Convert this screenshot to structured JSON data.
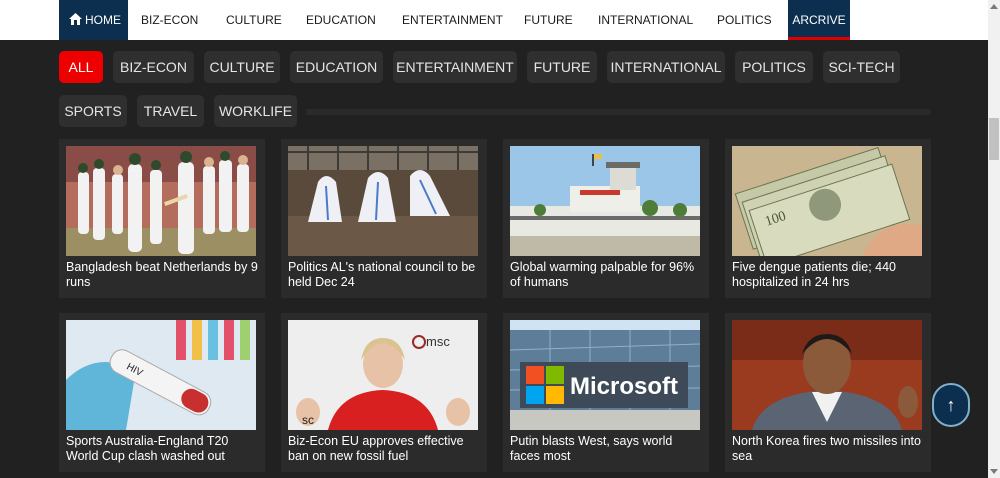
{
  "nav": {
    "home": "HOME",
    "items": [
      "BIZ-ECON",
      "CULTURE",
      "EDUCATION",
      "ENTERTAINMENT",
      "FUTURE",
      "INTERNATIONAL",
      "POLITICS"
    ],
    "active": "ARCRIVE"
  },
  "filters": [
    "ALL",
    "BIZ-ECON",
    "CULTURE",
    "EDUCATION",
    "ENTERTAINMENT",
    "FUTURE",
    "INTERNATIONAL",
    "POLITICS",
    "SCI-TECH",
    "SPORTS",
    "TRAVEL",
    "WORKLIFE"
  ],
  "active_filter": "ALL",
  "articles": [
    {
      "title": "Bangladesh beat Netherlands by 9 runs",
      "image": "cricket-players"
    },
    {
      "title": "Politics AL's national council to be held Dec 24",
      "image": "ppe-workers-grave"
    },
    {
      "title": "Global warming palpable for 96% of humans",
      "image": "airport-building"
    },
    {
      "title": "Five dengue patients die; 440 hospitalized in 24 hrs",
      "image": "dollar-bills"
    },
    {
      "title": "Sports Australia-England T20 World Cup clash washed out",
      "image": "hiv-test-tube"
    },
    {
      "title": "Biz-Econ EU approves effective ban on new fossil fuel",
      "image": "speaker-at-conference"
    },
    {
      "title": "Putin blasts West, says world faces most",
      "image": "microsoft-building"
    },
    {
      "title": "North Korea fires two missiles into sea",
      "image": "official-portrait"
    }
  ],
  "colors": {
    "nav_active": "#0d2f4f",
    "accent": "#ee0000",
    "background": "#212121",
    "card": "#2b2b2b"
  },
  "icons": {
    "home": "home-icon",
    "back_to_top": "arrow-up-icon"
  },
  "back_to_top_glyph": "↑"
}
